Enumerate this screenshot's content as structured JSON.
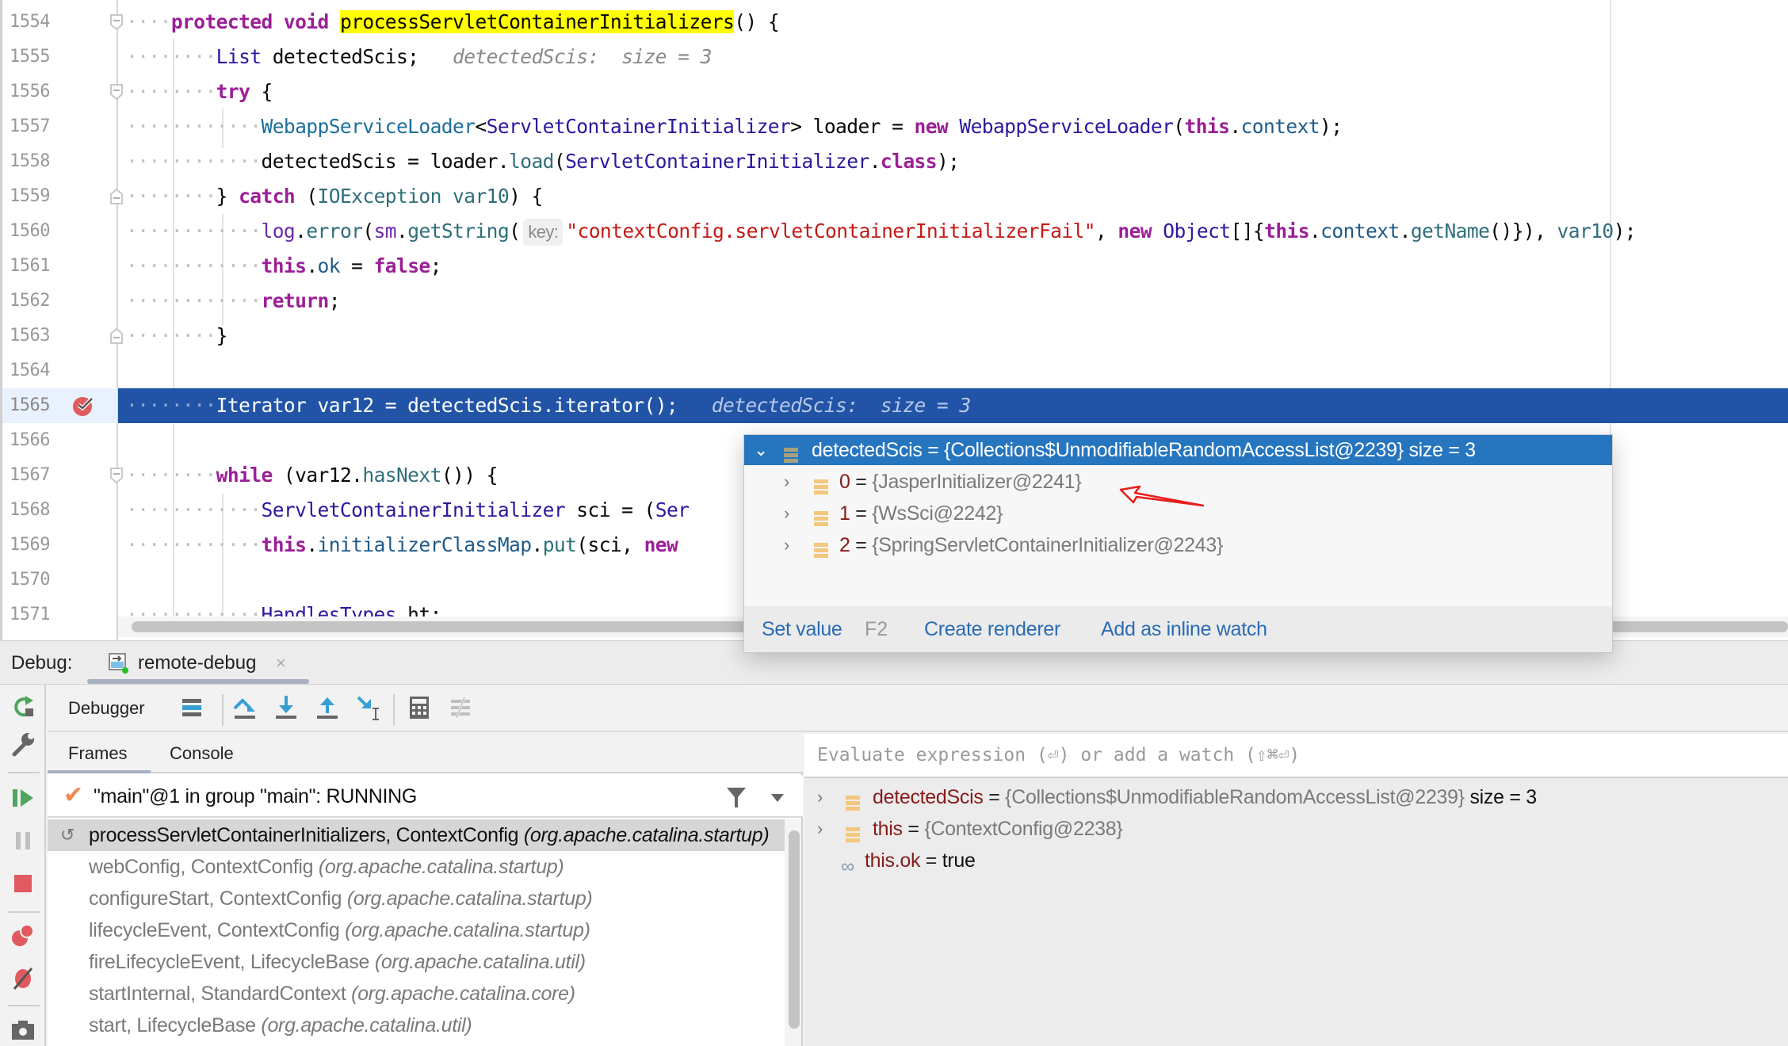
{
  "editor": {
    "lines": [
      {
        "num": "1554"
      },
      {
        "num": "1555"
      },
      {
        "num": "1556"
      },
      {
        "num": "1557"
      },
      {
        "num": "1558"
      },
      {
        "num": "1559"
      },
      {
        "num": "1560"
      },
      {
        "num": "1561"
      },
      {
        "num": "1562"
      },
      {
        "num": "1563"
      },
      {
        "num": "1564"
      },
      {
        "num": "1565"
      },
      {
        "num": "1566"
      },
      {
        "num": "1567"
      },
      {
        "num": "1568"
      },
      {
        "num": "1569"
      },
      {
        "num": "1570"
      },
      {
        "num": "1571"
      }
    ],
    "code": {
      "l1554": {
        "kw1": "protected",
        "kw2": "void",
        "method": "processServletContainerInitializers",
        "rest": "() {"
      },
      "l1555": {
        "type": "List",
        "rest": " detectedScis;",
        "hint": "detectedScis:  size = 3"
      },
      "l1556": {
        "kw": "try",
        "rest": " {"
      },
      "l1557": {
        "t1": "WebappServiceLoader",
        "lt": "<",
        "t2": "ServletContainerInitializer",
        "mid": "> loader = ",
        "kw": "new",
        "t3": "WebappServiceLoader",
        "p1": "(",
        "kw2": "this",
        "dot": ".",
        "f": "context",
        "end": ");"
      },
      "l1558": {
        "a": "detectedScis = loader.",
        "m": "load",
        "p": "(",
        "t": "ServletContainerInitializer",
        "dot": ".",
        "kw": "class",
        "end": ");"
      },
      "l1559": {
        "a": "} ",
        "kw": "catch",
        "p": " (",
        "t": "IOException",
        "v": " var10",
        "end": ") {"
      },
      "l1560": {
        "f1": "log",
        "d1": ".",
        "m1": "error",
        "p1": "(",
        "f2": "sm",
        "d2": ".",
        "m2": "getString",
        "p2": "(",
        "param_hint": "key:",
        "str": "\"contextConfig.servletContainerInitializerFail\"",
        "c": ", ",
        "kw": "new",
        "t": " Object",
        "b": "[]{",
        "kw2": "this",
        "d3": ".",
        "f3": "context",
        "d4": ".",
        "m3": "getName",
        "e1": "()}), ",
        "v": "var10",
        "end": ");"
      },
      "l1561": {
        "kw": "this",
        "d": ".",
        "f": "ok",
        "eq": " = ",
        "kw2": "false",
        "end": ";"
      },
      "l1562": {
        "kw": "return",
        "end": ";"
      },
      "l1563": {
        "a": "}"
      },
      "l1565": {
        "code": "Iterator var12 = detectedScis.iterator();",
        "hint": "detectedScis:  size = 3"
      },
      "l1567": {
        "kw": "while",
        "a": " (var12.",
        "m": "hasNext",
        "end": "()) {"
      },
      "l1568": {
        "t": "ServletContainerInitializer",
        "a": " sci = (",
        "t2": "Ser"
      },
      "l1569": {
        "kw": "this",
        "d": ".",
        "f": "initializerClassMap",
        "d2": ".",
        "m": "put",
        "a": "(sci, ",
        "kw2": "new"
      },
      "l1571": {
        "t": "HandlesTypes",
        "a": " ht;"
      }
    },
    "current_line": "1565",
    "breakpoint_line": "1565"
  },
  "popup": {
    "header": {
      "name": "detectedScis",
      "eq": " = ",
      "value": "{Collections$UnmodifiableRandomAccessList@2239}",
      "size": "  size = 3"
    },
    "items": [
      {
        "name": "0",
        "eq": " = ",
        "value": "{JasperInitializer@2241}"
      },
      {
        "name": "1",
        "eq": " = ",
        "value": "{WsSci@2242}"
      },
      {
        "name": "2",
        "eq": " = ",
        "value": "{SpringServletContainerInitializer@2243}"
      }
    ],
    "footer": {
      "set_value": "Set value",
      "set_value_key": "F2",
      "create_renderer": "Create renderer",
      "add_inline_watch": "Add as inline watch"
    }
  },
  "debug": {
    "label": "Debug:",
    "tab": {
      "label": "remote-debug",
      "close": "×"
    },
    "toolbar": {
      "label": "Debugger"
    },
    "subtabs": {
      "frames": "Frames",
      "console": "Console"
    },
    "thread": {
      "label": "\"main\"@1 in group \"main\": RUNNING"
    },
    "frames": [
      {
        "name": "processServletContainerInitializers, ContextConfig ",
        "pkg": "(org.apache.catalina.startup)",
        "selected": true
      },
      {
        "name": "webConfig, ContextConfig ",
        "pkg": "(org.apache.catalina.startup)"
      },
      {
        "name": "configureStart, ContextConfig ",
        "pkg": "(org.apache.catalina.startup)"
      },
      {
        "name": "lifecycleEvent, ContextConfig ",
        "pkg": "(org.apache.catalina.startup)"
      },
      {
        "name": "fireLifecycleEvent, LifecycleBase ",
        "pkg": "(org.apache.catalina.util)"
      },
      {
        "name": "startInternal, StandardContext ",
        "pkg": "(org.apache.catalina.core)"
      },
      {
        "name": "start, LifecycleBase ",
        "pkg": "(org.apache.catalina.util)"
      }
    ],
    "evaluate": {
      "placeholder": "Evaluate expression (⏎) or add a watch (⇧⌘⏎)"
    },
    "variables": [
      {
        "name": "detectedScis",
        "eq": " = ",
        "value": "{Collections$UnmodifiableRandomAccessList@2239}",
        "size": "  size = 3"
      },
      {
        "name": "this",
        "eq": " = ",
        "value": "{ContextConfig@2238}",
        "size": ""
      },
      {
        "name": "this.ok",
        "eq": " = ",
        "value": "true",
        "size": ""
      }
    ]
  },
  "colors": {
    "current_line": "#2154a6",
    "popup_header": "#2675bf",
    "keyword": "#9b1f97",
    "string": "#c41a16",
    "search_highlight": "#ffff00",
    "breakpoint": "#e05a5f",
    "link": "#2a6bb5"
  }
}
